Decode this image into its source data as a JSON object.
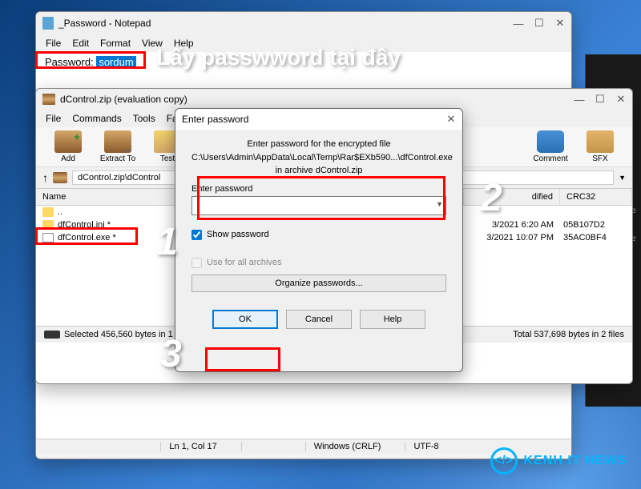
{
  "notepad": {
    "title": "_Password - Notepad",
    "menu": [
      "File",
      "Edit",
      "Format",
      "View",
      "Help"
    ],
    "content_label": "Password:",
    "content_value": "sordum",
    "statusbar": {
      "pos": "Ln 1, Col 17",
      "zoom": "",
      "eol": "Windows (CRLF)",
      "enc": "UTF-8"
    }
  },
  "winrar": {
    "title": "dControl.zip (evaluation copy)",
    "menu": [
      "File",
      "Commands",
      "Tools",
      "Favorite"
    ],
    "toolbar": {
      "add": "Add",
      "extract": "Extract To",
      "test": "Test",
      "comment": "Comment",
      "sfx": "SFX"
    },
    "address": "dControl.zip\\dControl",
    "columns": {
      "name": "Name",
      "modified": "dified",
      "crc": "CRC32"
    },
    "rows": {
      "up": "..",
      "ini": "dfControl.ini *",
      "ini_mod": "3/2021 6:20 AM",
      "ini_crc": "05B107D2",
      "exe": "dfControl.exe *",
      "exe_mod": "3/2021 10:07 PM",
      "exe_crc": "35AC0BF4"
    },
    "status": {
      "left": "Selected 456,560 bytes in 1 file",
      "right": "Total 537,698 bytes in 2 files"
    }
  },
  "dialog": {
    "title": "Enter password",
    "prompt_line1": "Enter password for the encrypted file",
    "prompt_line2": "C:\\Users\\Admin\\AppData\\Local\\Temp\\Rar$EXb590...\\dfControl.exe",
    "prompt_line3": "in archive dControl.zip",
    "field_label": "Enter password",
    "field_value": "",
    "show_pw": "Show password",
    "use_all": "Use for all archives",
    "organize": "Organize passwords...",
    "ok": "OK",
    "cancel": "Cancel",
    "help": "Help"
  },
  "annotations": {
    "instruction": "Lấy passwword tại đây",
    "n1": "1",
    "n2": "2",
    "n3": "3"
  },
  "dark_window": {
    "tag1": "ive",
    "tag2": "ile"
  },
  "logo": {
    "symbol": "</>",
    "text": "KENH IT NEWS"
  }
}
